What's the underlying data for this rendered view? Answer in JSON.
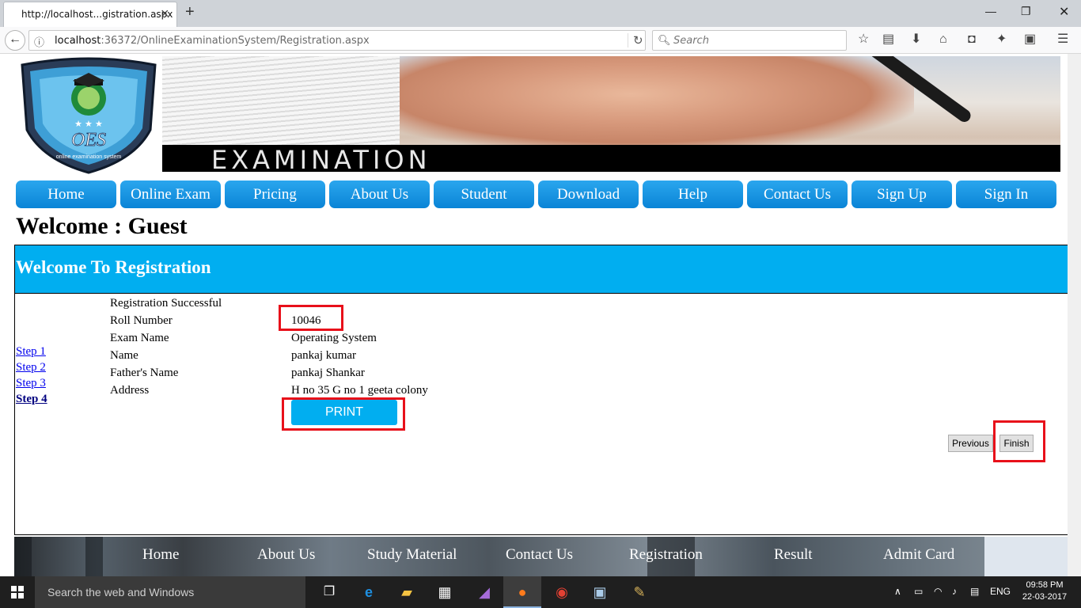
{
  "browser": {
    "tab_title": "http://localhost...gistration.aspx",
    "url_host": "localhost",
    "url_path": ":36372/OnlineExaminationSystem/Registration.aspx",
    "search_placeholder": "Search"
  },
  "header": {
    "logo_text": "OES",
    "logo_subtext": "online examination system",
    "banner_title": "EXAMINATION"
  },
  "menu": [
    "Home",
    "Online Exam",
    "Pricing",
    "About Us",
    "Student",
    "Download",
    "Help",
    "Contact Us",
    "Sign Up",
    "Sign In"
  ],
  "welcome": "Welcome : Guest",
  "registration": {
    "heading": "Welcome To Registration",
    "steps": [
      "Step 1",
      "Step 2",
      "Step 3",
      "Step 4"
    ],
    "current_step": "Step 4",
    "status": "Registration Successful",
    "fields": [
      {
        "label": "Roll Number",
        "value": "10046"
      },
      {
        "label": "Exam Name",
        "value": "Operating System"
      },
      {
        "label": "Name",
        "value": "pankaj kumar"
      },
      {
        "label": "Father's Name",
        "value": "pankaj Shankar"
      },
      {
        "label": "Address",
        "value": "H no 35 G no 1 geeta colony"
      }
    ],
    "print_label": "PRINT",
    "previous_label": "Previous",
    "finish_label": "Finish",
    "highlight_color": "#e8101a"
  },
  "footer": [
    "Home",
    "About Us",
    "Study Material",
    "Contact Us",
    "Registration",
    "Result",
    "Admit Card"
  ],
  "taskbar": {
    "search_text": "Search the web and Windows",
    "language": "ENG",
    "time": "09:58 PM",
    "date": "22-03-2017"
  },
  "colors": {
    "accent": "#01aef0",
    "menu_button": "#0a84d6"
  }
}
